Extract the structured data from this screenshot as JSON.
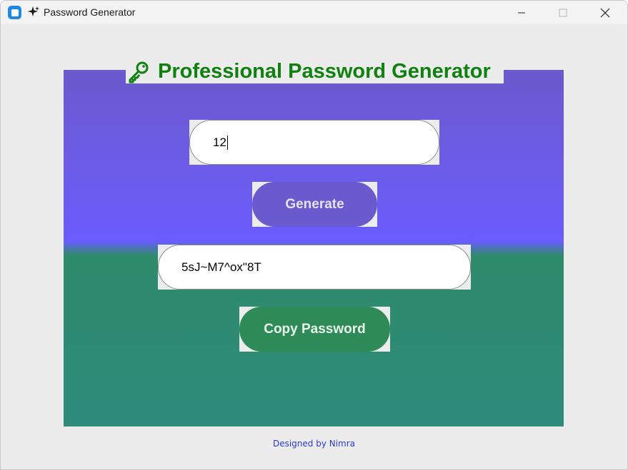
{
  "window": {
    "title": "Password Generator",
    "app_icon": "app-icon",
    "sparkle_icon": "sparkle-icon",
    "controls": [
      "minimize-icon",
      "maximize-icon",
      "close-icon"
    ]
  },
  "header": {
    "icon": "key-icon",
    "title": "Professional Password Generator"
  },
  "length_input": {
    "value": "12"
  },
  "generate_button": {
    "label": "Generate"
  },
  "password_output": {
    "value": "5sJ~M7^ox\"8T"
  },
  "copy_button": {
    "label": "Copy Password"
  },
  "footer": {
    "text": "Designed by Nimra"
  },
  "colors": {
    "heading": "#108010",
    "generate_button": "#6a5acd",
    "copy_button": "#2e8b57",
    "panel_top": "#6a5acd",
    "panel_bottom": "#2e8b7b",
    "footer": "#2a3bd6"
  }
}
